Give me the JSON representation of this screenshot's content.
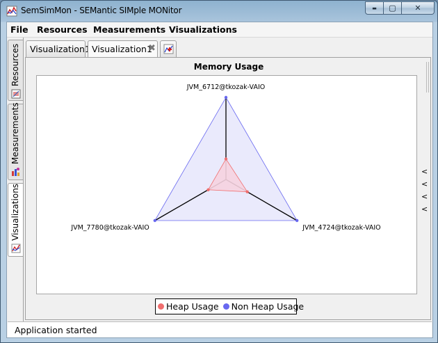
{
  "window": {
    "title": "SemSimMon - SEMantic SIMple MONitor",
    "minimize_glyph": "▬",
    "maximize_glyph": "▢",
    "close_glyph": "✕"
  },
  "menu": {
    "items": [
      "File",
      "Resources",
      "Measurements",
      "Visualizations"
    ]
  },
  "left_tabs": {
    "items": [
      {
        "label": "Resources",
        "icon": "resources-icon"
      },
      {
        "label": "Measurements",
        "icon": "measurements-icon"
      },
      {
        "label": "Visualizations",
        "icon": "visualizations-icon"
      }
    ],
    "active": "Visualizations"
  },
  "tabs": {
    "items": [
      {
        "label": "Visualization1",
        "closable": false
      },
      {
        "label": "Visualization1",
        "closable": true
      }
    ],
    "close_glyph": "✖",
    "add_icon": "add-chart-icon",
    "active_index": 1
  },
  "side_arrows": [
    "<",
    "<",
    "<",
    "<"
  ],
  "status": {
    "text": "Application started"
  },
  "colors": {
    "heap": "#f06e6e",
    "non_heap": "#6868f0",
    "non_heap_fill": "#e6e6fb",
    "heap_fill": "#f6d3e0",
    "axis": "#000000"
  },
  "chart_data": {
    "type": "radar",
    "title": "Memory Usage",
    "axes": [
      "JVM_6712@tkozak-VAIO",
      "JVM_4724@tkozak-VAIO",
      "JVM_7780@tkozak-VAIO"
    ],
    "series": [
      {
        "name": "Heap Usage",
        "values": [
          0.25,
          0.3,
          0.25
        ]
      },
      {
        "name": "Non Heap Usage",
        "values": [
          1.0,
          1.0,
          1.0
        ]
      }
    ],
    "range": [
      0,
      1
    ],
    "legend_position": "bottom"
  }
}
